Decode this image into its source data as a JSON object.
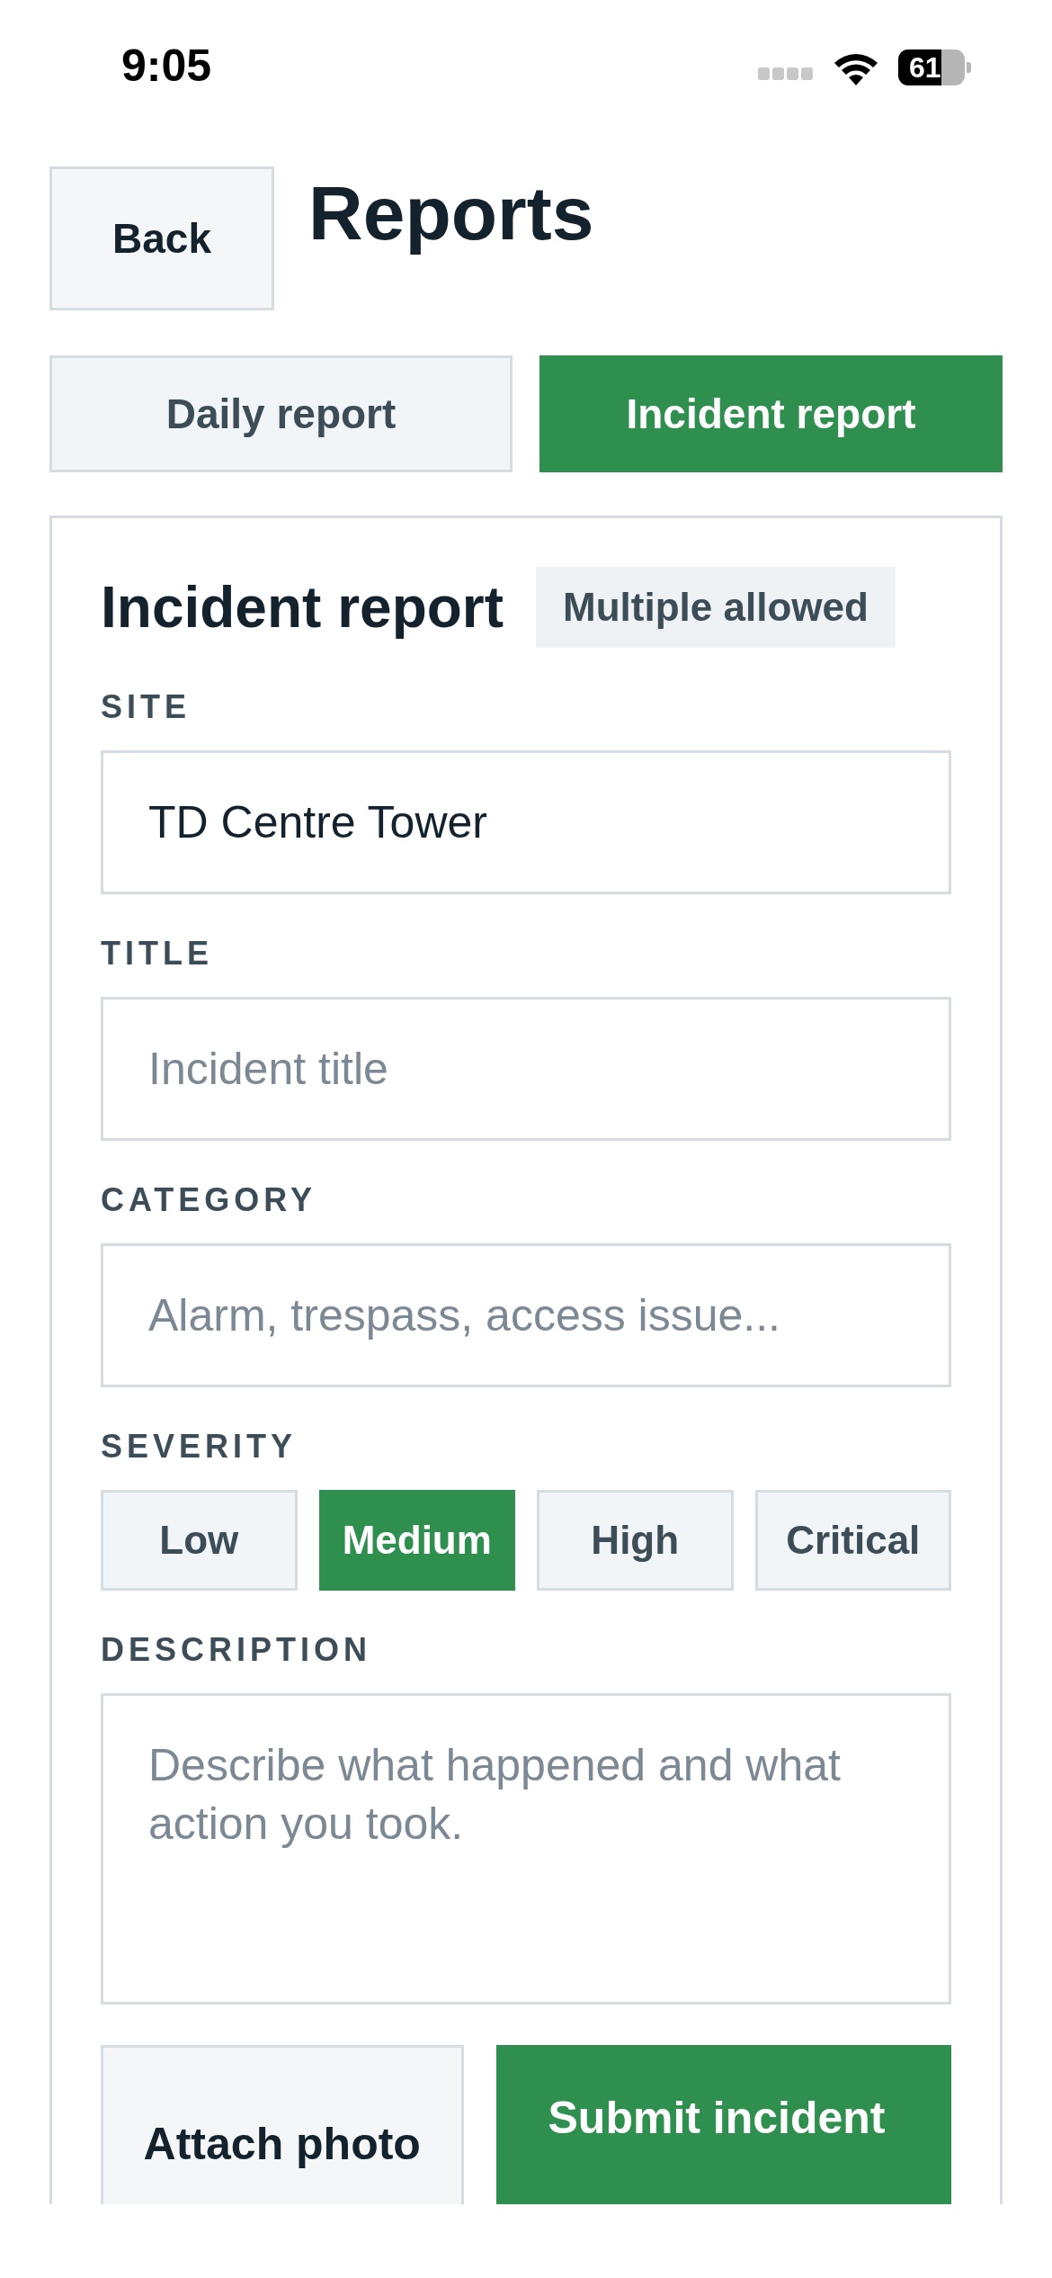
{
  "status_bar": {
    "time": "9:05",
    "battery": "61"
  },
  "header": {
    "back_button": "Back",
    "title": "Reports"
  },
  "tabs": [
    {
      "label": "Daily report",
      "selected": false
    },
    {
      "label": "Incident report",
      "selected": true
    }
  ],
  "form": {
    "title": "Incident report",
    "badge": "Multiple allowed",
    "fields": [
      {
        "kind": "text",
        "label": "SITE",
        "value": "TD Centre Tower"
      },
      {
        "kind": "text",
        "label": "TITLE",
        "placeholder": "Incident title"
      },
      {
        "kind": "text",
        "label": "CATEGORY",
        "placeholder": "Alarm, trespass, access issue..."
      },
      {
        "kind": "segments",
        "label": "SEVERITY",
        "options": [
          {
            "label": "Low",
            "selected": false
          },
          {
            "label": "Medium",
            "selected": true
          },
          {
            "label": "High",
            "selected": false
          },
          {
            "label": "Critical",
            "selected": false
          }
        ]
      },
      {
        "kind": "textarea",
        "label": "DESCRIPTION",
        "placeholder": "Describe what happened and what action you took."
      }
    ],
    "actions": [
      {
        "label": "Attach photo",
        "primary": false
      },
      {
        "label": "Submit incident",
        "primary": true
      }
    ]
  }
}
